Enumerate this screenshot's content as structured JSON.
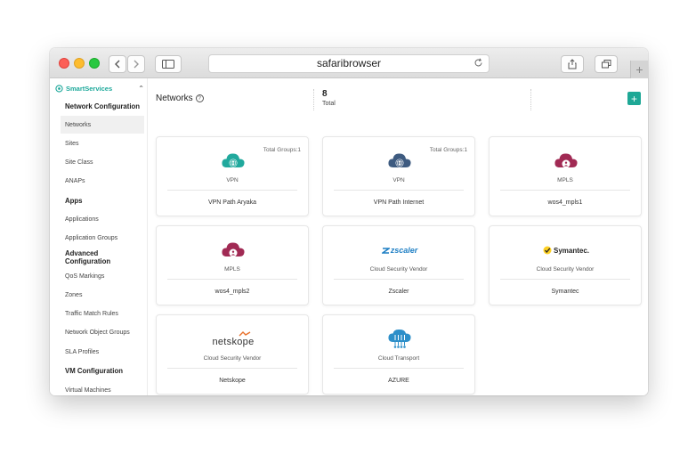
{
  "browser": {
    "address": "safaribrowser"
  },
  "sidebar": {
    "brand": "SmartServices",
    "items": [
      {
        "label": "Network Configuration",
        "section": true
      },
      {
        "label": "Networks",
        "active": true
      },
      {
        "label": "Sites"
      },
      {
        "label": "Site Class"
      },
      {
        "label": "ANAPs"
      },
      {
        "label": "Apps",
        "section": true
      },
      {
        "label": "Applications"
      },
      {
        "label": "Application Groups"
      },
      {
        "label": "Advanced Configuration",
        "section": true
      },
      {
        "label": "QoS Markings"
      },
      {
        "label": "Zones"
      },
      {
        "label": "Traffic Match Rules"
      },
      {
        "label": "Network Object Groups"
      },
      {
        "label": "SLA Profiles"
      },
      {
        "label": "VM Configuration",
        "section": true
      },
      {
        "label": "Virtual Machines"
      }
    ]
  },
  "header": {
    "title": "Networks",
    "help_glyph": "?",
    "total_value": "8",
    "total_label": "Total",
    "add_glyph": "+"
  },
  "cards": [
    {
      "icon": "cloud-globe-teal-icon",
      "color": "#21a99d",
      "type": "VPN",
      "name": "VPN Path Aryaka",
      "badge": "Total Groups:1"
    },
    {
      "icon": "cloud-globe-slate-icon",
      "color": "#3e5b80",
      "type": "VPN",
      "name": "VPN Path Internet",
      "badge": "Total Groups:1"
    },
    {
      "icon": "cloud-person-crimson-icon",
      "color": "#a12a54",
      "type": "MPLS",
      "name": "wos4_mpls1",
      "badge": ""
    },
    {
      "icon": "cloud-person-crimson-icon",
      "color": "#a12a54",
      "type": "MPLS",
      "name": "wos4_mpls2",
      "badge": ""
    },
    {
      "icon": "zscaler-logo",
      "logo_text": "zscaler",
      "type": "Cloud Security Vendor",
      "name": "Zscaler",
      "badge": ""
    },
    {
      "icon": "symantec-logo",
      "logo_text": "Symantec.",
      "type": "Cloud Security Vendor",
      "name": "Symantec",
      "badge": ""
    },
    {
      "icon": "netskope-logo",
      "logo_text": "netskope",
      "type": "Cloud Security Vendor",
      "name": "Netskope",
      "badge": ""
    },
    {
      "icon": "cloud-transport-icon",
      "color": "#2d8fc9",
      "type": "Cloud Transport",
      "name": "AZURE",
      "badge": ""
    }
  ]
}
